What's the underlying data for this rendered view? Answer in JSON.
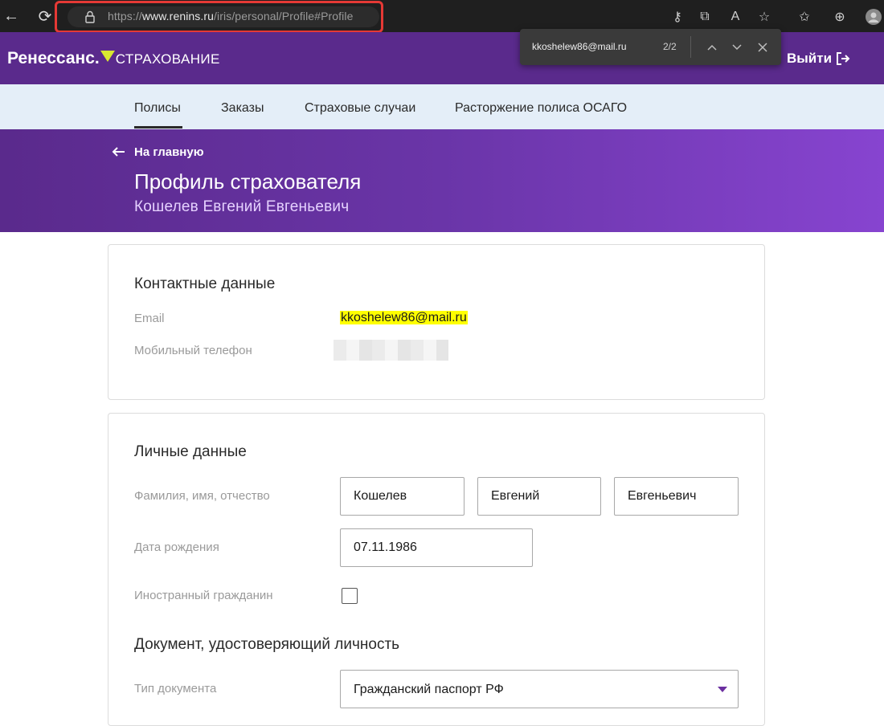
{
  "browser": {
    "url_prefix": "https://",
    "url_domain": "www.renins.ru",
    "url_path": "/iris/personal/Profile#Profile"
  },
  "find": {
    "query": "kkoshelew86@mail.ru",
    "count": "2/2"
  },
  "header": {
    "logo_main": "Ренессанс",
    "logo_sub": "СТРАХОВАНИЕ",
    "logout_label": "Выйти"
  },
  "nav": {
    "tabs": [
      "Полисы",
      "Заказы",
      "Страховые случаи",
      "Расторжение полиса ОСАГО"
    ],
    "active_index": 0
  },
  "hero": {
    "back_label": "На главную",
    "title": "Профиль страхователя",
    "subtitle": "Кошелев Евгений Евгеньевич"
  },
  "contact": {
    "title": "Контактные данные",
    "email_label": "Email",
    "email_value": "kkoshelew86@mail.ru",
    "phone_label": "Мобильный телефон"
  },
  "personal": {
    "title": "Личные данные",
    "fio_label": "Фамилия, имя, отчество",
    "last_name": "Кошелев",
    "first_name": "Евгений",
    "middle_name": "Евгеньевич",
    "birth_label": "Дата рождения",
    "birth_date": "07.11.1986",
    "foreign_label": "Иностранный гражданин",
    "foreign_checked": false
  },
  "document": {
    "title": "Документ, удостоверяющий личность",
    "type_label": "Тип документа",
    "type_value": "Гражданский паспорт РФ"
  },
  "colors": {
    "brand_purple": "#5a2a8c",
    "accent_yellow": "#d8e830",
    "highlight": "#ffff00",
    "nav_bg": "#e4eef8"
  }
}
